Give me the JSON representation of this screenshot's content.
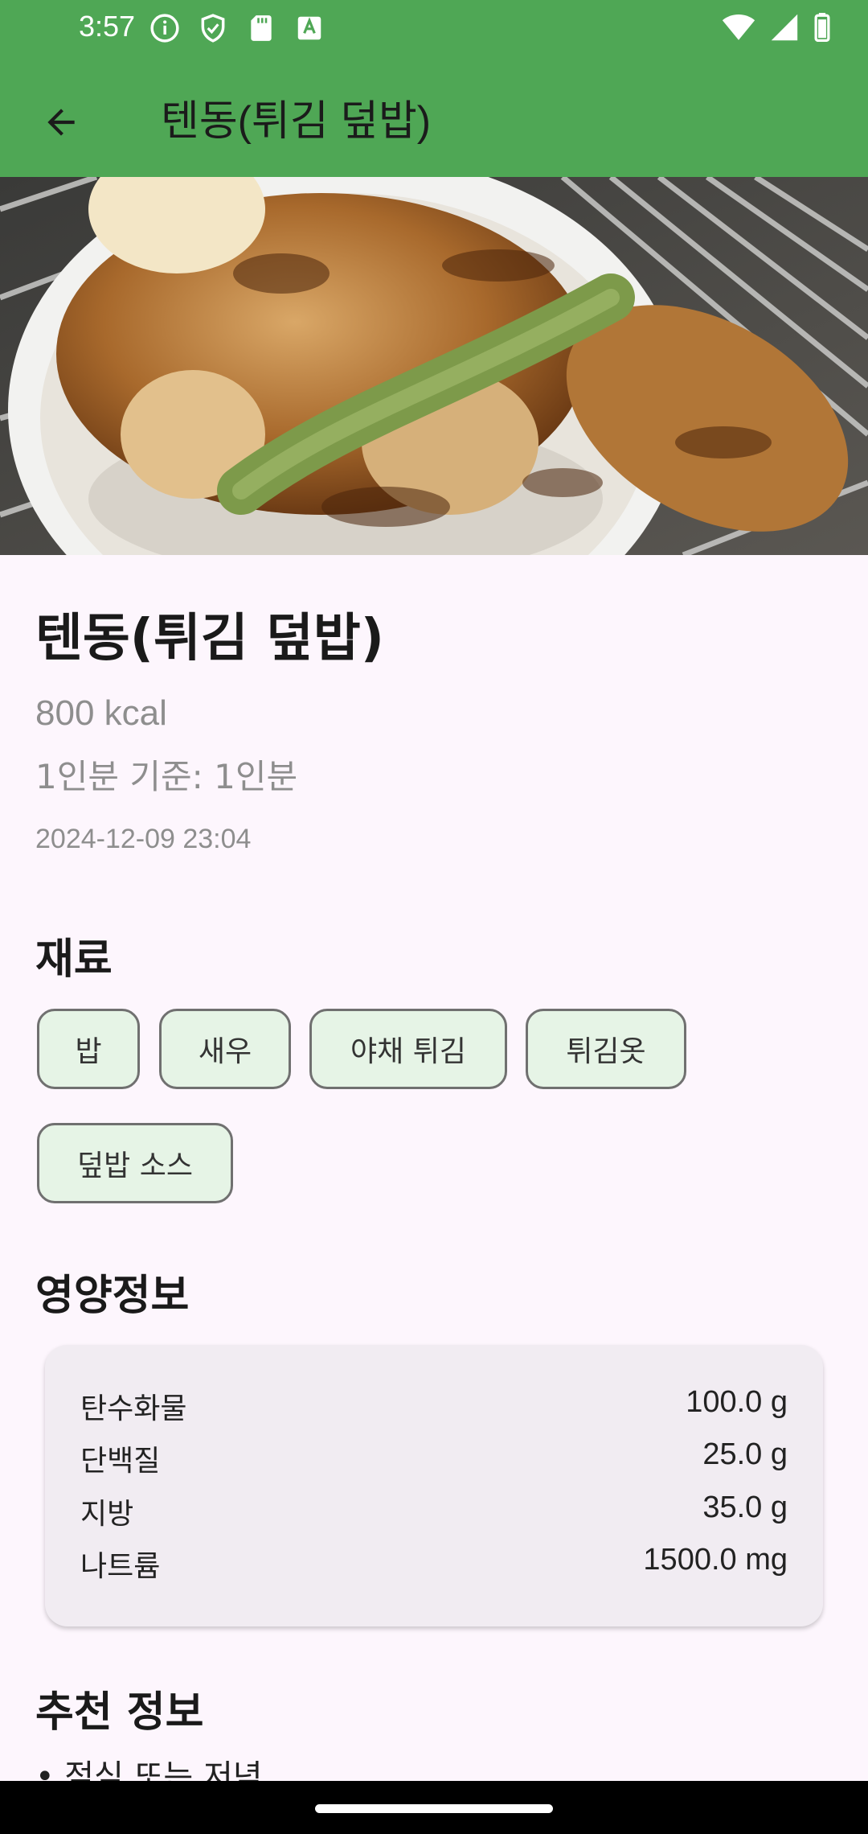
{
  "status_bar": {
    "time": "3:57",
    "icons_left": [
      "info-icon",
      "shield-icon",
      "sd-card-icon",
      "keyboard-a-icon"
    ],
    "icons_right": [
      "wifi-icon",
      "signal-icon",
      "battery-icon"
    ]
  },
  "app_bar": {
    "title": "텐동(튀김 덮밥)",
    "back_icon": "arrow-back-icon",
    "color": "#4fa755"
  },
  "hero_image": {
    "description": "tendon-photo"
  },
  "food": {
    "name": "텐동(튀김 덮밥)",
    "calories": "800 kcal",
    "serving": "1인분 기준: 1인분",
    "date": "2024-12-09 23:04"
  },
  "ingredients": {
    "title": "재료",
    "items": [
      "밥",
      "새우",
      "야채 튀김",
      "튀김옷",
      "덮밥 소스"
    ]
  },
  "nutrition": {
    "title": "영양정보",
    "rows": [
      {
        "label": "탄수화물",
        "value": "100.0 g"
      },
      {
        "label": "단백질",
        "value": "25.0 g"
      },
      {
        "label": "지방",
        "value": "35.0 g"
      },
      {
        "label": "나트륨",
        "value": "1500.0 mg"
      }
    ]
  },
  "recommendation": {
    "title": "추천 정보",
    "item": "• 점심 또는 저녁"
  }
}
